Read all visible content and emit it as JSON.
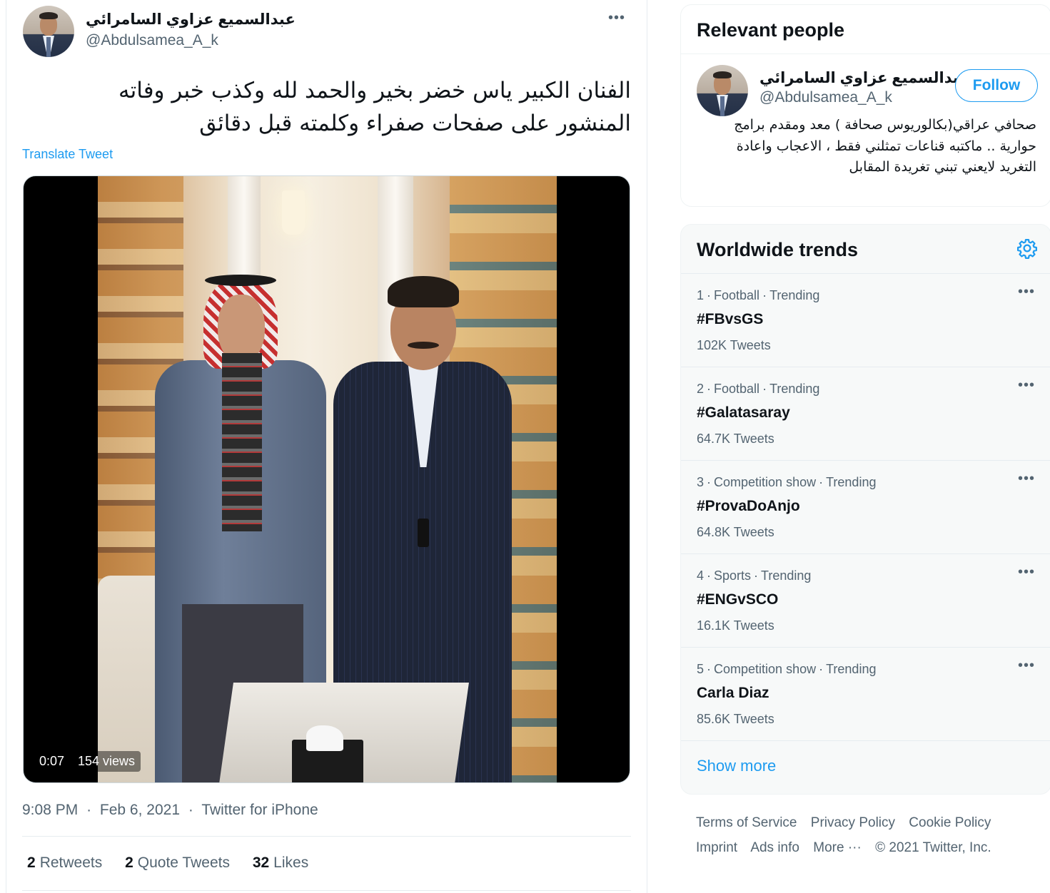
{
  "tweet": {
    "author_name": "عبدالسميع عزاوي السامرائي",
    "author_handle": "@Abdulsamea_A_k",
    "more_label": "•••",
    "text_line1": "الفنان الكبير ياس خضر بخير والحمد لله وكذب خبر وفاته",
    "text_line2": "المنشور على صفحات صفراء وكلمته قبل دقائق",
    "translate_label": "Translate Tweet",
    "video": {
      "duration": "0:07",
      "views": "154 views"
    },
    "time": "9:08 PM",
    "date": "Feb 6, 2021",
    "source": "Twitter for iPhone",
    "separator": "·",
    "stats": {
      "retweets_count": "2",
      "retweets_label": "Retweets",
      "quotes_count": "2",
      "quotes_label": "Quote Tweets",
      "likes_count": "32",
      "likes_label": "Likes"
    }
  },
  "relevant_people": {
    "title": "Relevant people",
    "name": "عبدالسميع عزاوي السامرائي",
    "handle": "@Abdulsamea_A_k",
    "follow_label": "Follow",
    "bio": "صحافي عراقي(بكالوريوس صحافة ) معد ومقدم برامج حوارية .. ماكتبه قناعات تمثلني فقط ، الاعجاب واعادة التغريد لايعني تبني تغريدة المقابل"
  },
  "trends": {
    "title": "Worldwide trends",
    "settings_icon": "gear-icon",
    "items": [
      {
        "rank": "1",
        "category": "Football",
        "status": "Trending",
        "name": "#FBvsGS",
        "count": "102K Tweets"
      },
      {
        "rank": "2",
        "category": "Football",
        "status": "Trending",
        "name": "#Galatasaray",
        "count": "64.7K Tweets"
      },
      {
        "rank": "3",
        "category": "Competition show",
        "status": "Trending",
        "name": "#ProvaDoAnjo",
        "count": "64.8K Tweets"
      },
      {
        "rank": "4",
        "category": "Sports",
        "status": "Trending",
        "name": "#ENGvSCO",
        "count": "16.1K Tweets"
      },
      {
        "rank": "5",
        "category": "Competition show",
        "status": "Trending",
        "name": "Carla Diaz",
        "count": "85.6K Tweets"
      }
    ],
    "dot": "·",
    "more_label": "•••",
    "show_more": "Show more"
  },
  "footer": {
    "terms": "Terms of Service",
    "privacy": "Privacy Policy",
    "cookie": "Cookie Policy",
    "imprint": "Imprint",
    "ads": "Ads info",
    "more": "More ···",
    "copyright": "© 2021 Twitter, Inc."
  },
  "colors": {
    "accent": "#1d9bf0",
    "text_primary": "#0f1419",
    "text_secondary": "#536471",
    "sidebar_bg": "#f7f9f9",
    "border": "#e6ecf0"
  }
}
